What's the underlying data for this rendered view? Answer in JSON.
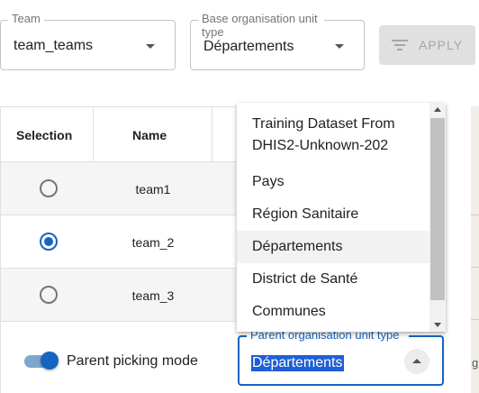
{
  "filters": {
    "team": {
      "label": "Team",
      "value": "team_teams"
    },
    "base_org_unit_type": {
      "label": "Base organisation unit type",
      "value": "Départements"
    },
    "apply_label": "APPLY"
  },
  "table": {
    "headers": {
      "selection": "Selection",
      "name": "Name"
    },
    "rows": [
      {
        "name": "team1",
        "selected": false
      },
      {
        "name": "team_2",
        "selected": true
      },
      {
        "name": "team_3",
        "selected": false
      }
    ]
  },
  "parent_picking": {
    "label": "Parent picking mode",
    "enabled": true
  },
  "parent_org_unit_type": {
    "label": "Parent organisation unit type",
    "value": "Départements"
  },
  "dropdown": {
    "options": [
      "Training Dataset From DHIS2-Unknown-202",
      "Pays",
      "Région Sanitaire",
      "Départements",
      "District de Santé",
      "Communes"
    ],
    "highlighted": "Départements"
  },
  "map_fragment_text": "g",
  "colors": {
    "accent": "#1565c0",
    "row_alt": "#f5f5f5",
    "disabled_button": "#e0e0e0"
  }
}
